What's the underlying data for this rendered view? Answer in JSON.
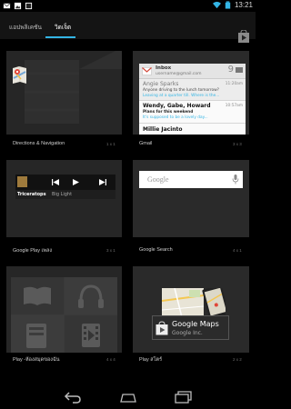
{
  "status": {
    "time": "13:21",
    "icons": [
      "gmail-icon",
      "gallery-icon",
      "blackboard-icon",
      "wifi-icon",
      "battery-icon"
    ]
  },
  "tabs": {
    "apps_label": "แอปพลิเคชัน",
    "widgets_label": "วิดเจ็ต",
    "active": "widgets",
    "accent": "#33b5e5"
  },
  "widgets": [
    {
      "caption": "Directions & Navigation",
      "size": "1 x 1"
    },
    {
      "caption": "Gmail",
      "size": "3 x 3"
    },
    {
      "caption": "Google Play เพลง",
      "size": "3 x 1"
    },
    {
      "caption": "Google Search",
      "size": "4 x 1"
    },
    {
      "caption": "Play -ห้องสมุดของฉัน",
      "size": "4 x 4"
    },
    {
      "caption": "Play สโตร์",
      "size": "2 x 2"
    }
  ],
  "gmail": {
    "inbox": "Inbox",
    "account": "username@gmail.com",
    "count": "9",
    "messages": [
      {
        "from": "Angie Sparks",
        "subject": "Anyone driving to the lunch tomorrow?",
        "preview": "Leaving at a quarter till. Where is the...",
        "time": "11:20am",
        "read": true
      },
      {
        "from": "Wendy, Gabe, Howard",
        "subject": "Plans for this weekend",
        "preview": "It's supposed to be a lovely day...",
        "time": "10:57am",
        "read": false
      },
      {
        "from": "Millie Jacinto",
        "subject": "",
        "preview": "",
        "time": "",
        "read": false
      }
    ]
  },
  "music": {
    "song": "Triceratops",
    "artist": "Big Light"
  },
  "search": {
    "placeholder": "Google"
  },
  "store_widget": {
    "title": "Google Maps",
    "developer": "Google Inc."
  }
}
